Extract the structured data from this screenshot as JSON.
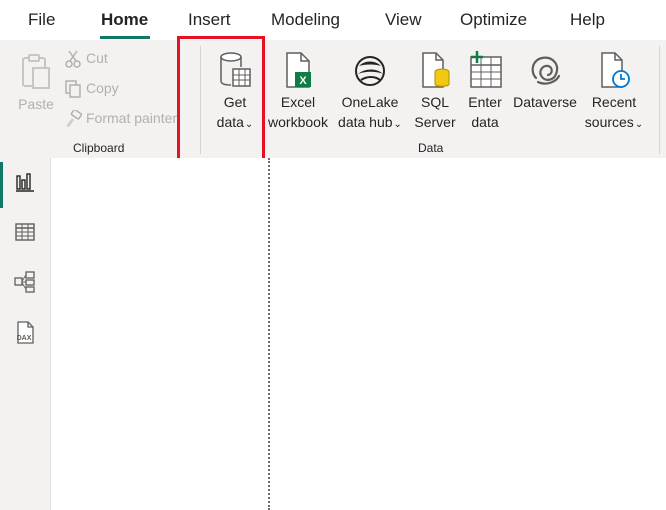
{
  "menu": {
    "items": [
      {
        "label": "File"
      },
      {
        "label": "Home"
      },
      {
        "label": "Insert"
      },
      {
        "label": "Modeling"
      },
      {
        "label": "View"
      },
      {
        "label": "Optimize"
      },
      {
        "label": "Help"
      }
    ],
    "active": "Home"
  },
  "ribbon": {
    "clipboard": {
      "paste": "Paste",
      "cut": "Cut",
      "copy": "Copy",
      "format_painter": "Format painter",
      "group_label": "Clipboard"
    },
    "data": {
      "get_data": {
        "line1": "Get",
        "line2": "data"
      },
      "excel": {
        "line1": "Excel",
        "line2": "workbook"
      },
      "onelake": {
        "line1": "OneLake",
        "line2": "data hub"
      },
      "sql": {
        "line1": "SQL",
        "line2": "Server"
      },
      "enter": {
        "line1": "Enter",
        "line2": "data"
      },
      "dataverse": {
        "line1": "Dataverse"
      },
      "recent": {
        "line1": "Recent",
        "line2": "sources"
      },
      "group_label": "Data"
    },
    "dropdown_glyph": "⌄"
  },
  "leftnav": {
    "icons": [
      "report-view-icon",
      "table-view-icon",
      "model-view-icon",
      "dax-query-view-icon"
    ],
    "dax_text": "DAX"
  },
  "colors": {
    "accent": "#117865",
    "highlight": "#e81123",
    "excel_green": "#107c41",
    "clock_blue": "#0078d4"
  }
}
